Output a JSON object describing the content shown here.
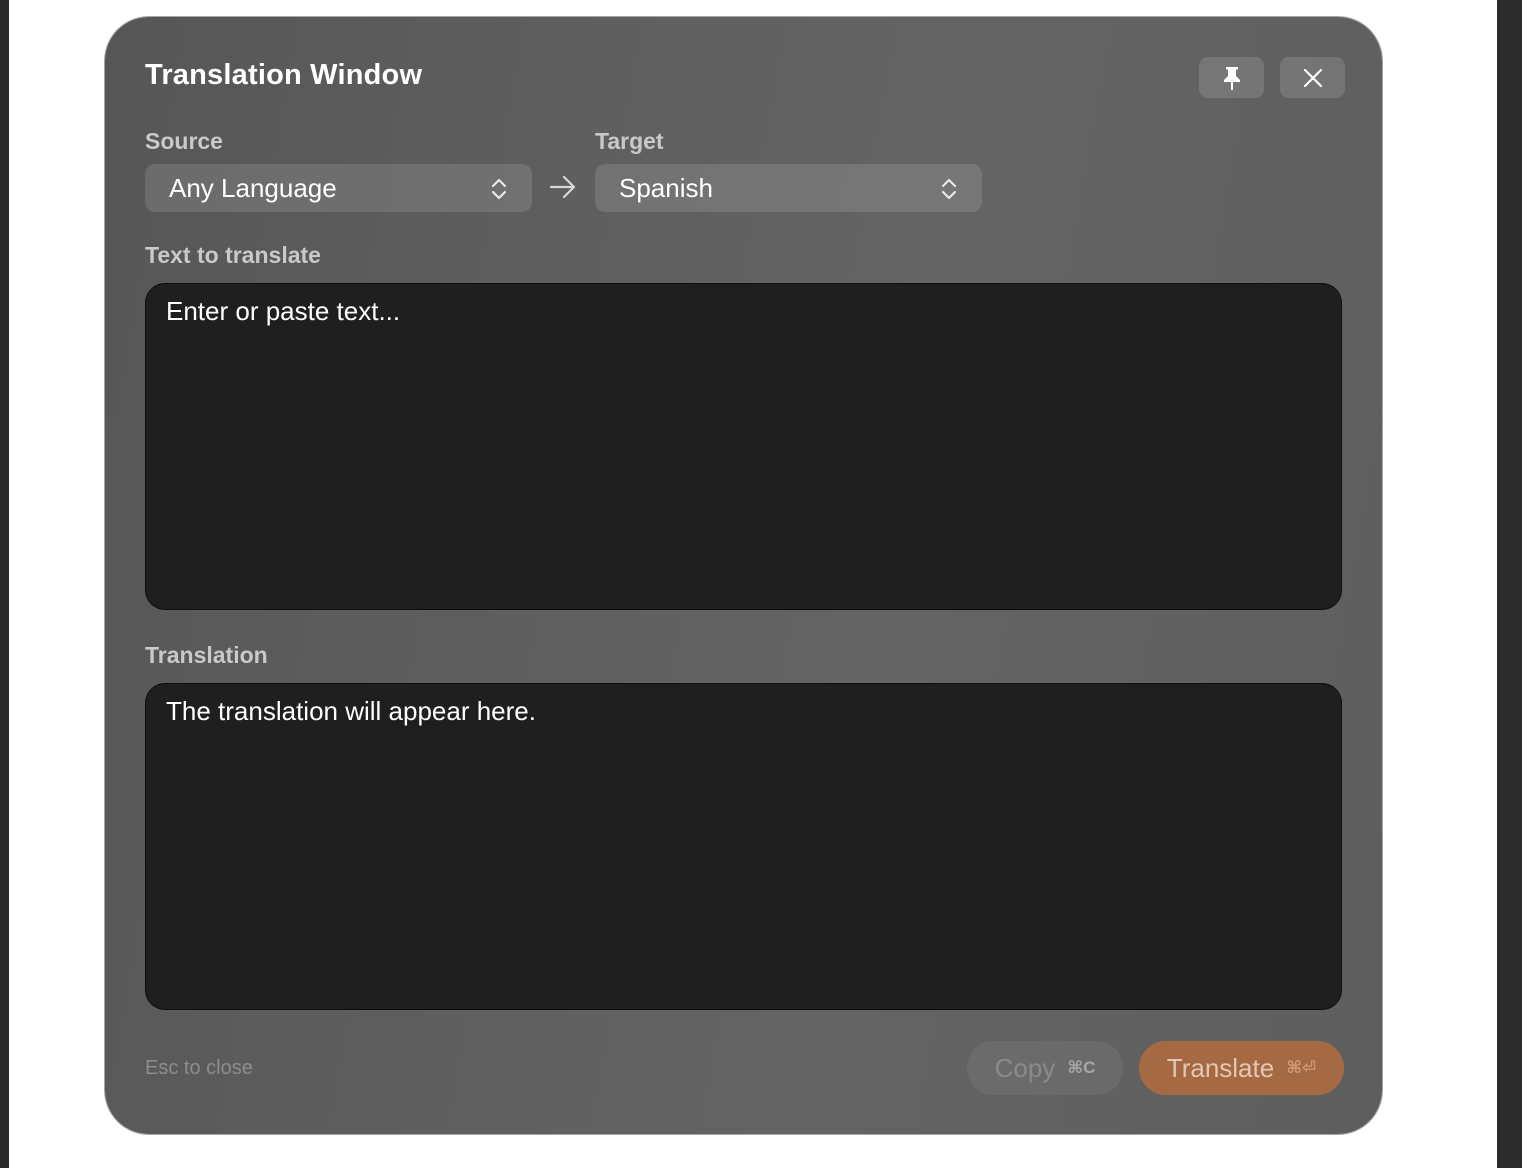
{
  "window": {
    "title": "Translation Window"
  },
  "header": {
    "pin_icon": "pin-icon",
    "close_icon": "close-icon"
  },
  "languages": {
    "source_label": "Source",
    "source_value": "Any Language",
    "arrow_icon": "arrow-right-icon",
    "target_label": "Target",
    "target_value": "Spanish",
    "chevron_icon": "chevron-up-down-icon"
  },
  "input": {
    "label": "Text to translate",
    "placeholder": "Enter or paste text..."
  },
  "output": {
    "label": "Translation",
    "placeholder": "The translation will appear here."
  },
  "footer": {
    "hint": "Esc to close",
    "copy_label": "Copy",
    "copy_shortcut": "⌘C",
    "translate_label": "Translate",
    "translate_shortcut": "⌘⏎"
  },
  "colors": {
    "window_background": "#5e5e5e",
    "textbox_background": "#1f1f1f",
    "accent": "#a56a43"
  }
}
